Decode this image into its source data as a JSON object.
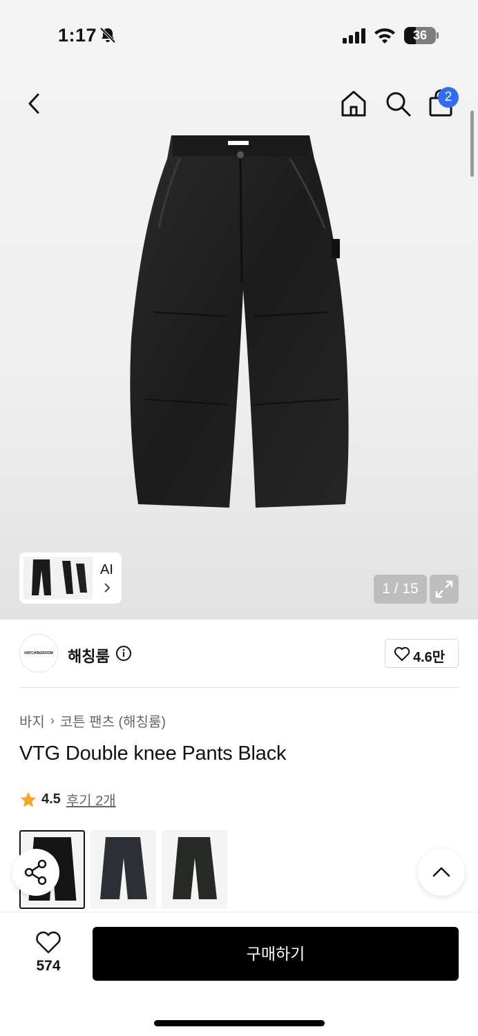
{
  "status_bar": {
    "time": "1:17",
    "battery": "36"
  },
  "header": {
    "cart_count": "2"
  },
  "gallery": {
    "ai_label": "AI",
    "counter": "1 / 15"
  },
  "store": {
    "logo_text": "HATCHINGROOM",
    "name": "해칭룸",
    "likes": "4.6만"
  },
  "breadcrumb": {
    "category": "바지",
    "subcategory": "코튼 팬츠 (해칭룸)"
  },
  "product": {
    "title": "VTG Double knee Pants Black",
    "rating": "4.5",
    "review_link": "후기 2개"
  },
  "bottom": {
    "wish_count": "574",
    "buy_label": "구매하기"
  },
  "colors": {
    "badge": "#2f6ef3",
    "star": "#f5a623",
    "buy": "#000000"
  }
}
